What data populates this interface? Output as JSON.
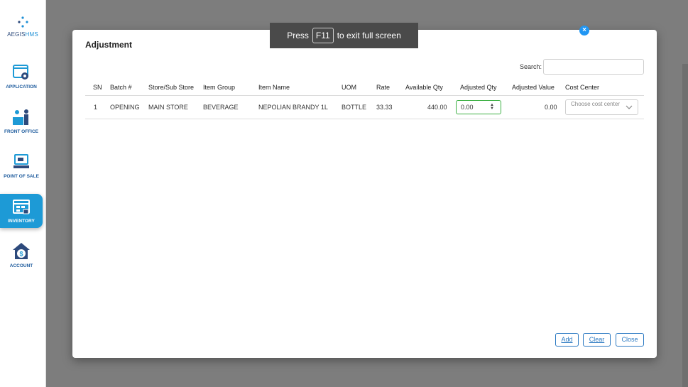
{
  "app": {
    "logo_prefix": "AEGIS",
    "logo_suffix": "HMS"
  },
  "sidebar": {
    "items": [
      {
        "label": "APPLICATION",
        "icon": "application-icon"
      },
      {
        "label": "FRONT OFFICE",
        "icon": "front-office-icon"
      },
      {
        "label": "POINT OF SALE",
        "icon": "point-of-sale-icon"
      },
      {
        "label": "INVENTORY",
        "icon": "inventory-icon",
        "active": true
      },
      {
        "label": "ACCOUNT",
        "icon": "account-icon"
      }
    ]
  },
  "fullscreen_notice": {
    "prefix": "Press",
    "key": "F11",
    "suffix": "to exit full screen"
  },
  "modal": {
    "title": "Adjustment",
    "search_label": "Search:",
    "columns": [
      "SN",
      "Batch #",
      "Store/Sub Store",
      "Item Group",
      "Item Name",
      "UOM",
      "Rate",
      "Available Qty",
      "Adjusted Qty",
      "Adjusted Value",
      "Cost Center"
    ],
    "rows": [
      {
        "sn": "1",
        "batch": "OPENING",
        "store": "MAIN STORE",
        "group": "BEVERAGE",
        "item": "NEPOLIAN BRANDY 1L",
        "uom": "BOTTLE",
        "rate": "33.33",
        "available_qty": "440.00",
        "adjusted_qty": "0.00",
        "adjusted_value": "0.00",
        "cost_center_placeholder": "Choose cost center"
      }
    ],
    "buttons": {
      "add": "Add",
      "clear": "Clear",
      "close": "Close"
    }
  },
  "colors": {
    "accent": "#1d9ad6",
    "button_border": "#2b79c2",
    "focus_border": "#3cb043",
    "overlay": "#7d7d7d"
  }
}
